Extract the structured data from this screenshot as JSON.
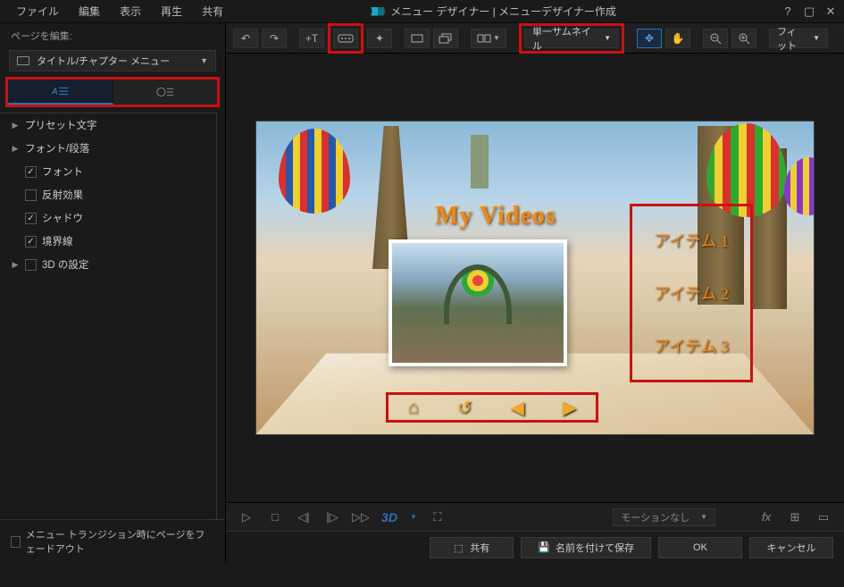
{
  "menubar": {
    "file": "ファイル",
    "edit": "編集",
    "view": "表示",
    "play": "再生",
    "share": "共有"
  },
  "window": {
    "title": "メニュー デザイナー | メニューデザイナー作成"
  },
  "sidebar": {
    "header": "ページを編集:",
    "page_dropdown": "タイトル/チャプター メニュー",
    "panels": {
      "preset": "プリセット文字",
      "font_para": "フォント/段落",
      "font": "フォント",
      "reflection": "反射効果",
      "shadow": "シャドウ",
      "border": "境界線",
      "threed": "3D の設定"
    },
    "fade_checkbox": "メニュー トランジション時にページをフェードアウト"
  },
  "toolbar": {
    "thumbnail_mode": "単一サムネイル",
    "zoom_fit": "フィット"
  },
  "canvas": {
    "title": "My Videos",
    "items": [
      "アイテム 1",
      "アイテム 2",
      "アイテム 3"
    ]
  },
  "playback": {
    "motion_dropdown": "モーションなし",
    "threed_label": "3D"
  },
  "footer": {
    "share": "共有",
    "save_as": "名前を付けて保存",
    "ok": "OK",
    "cancel": "キャンセル"
  }
}
